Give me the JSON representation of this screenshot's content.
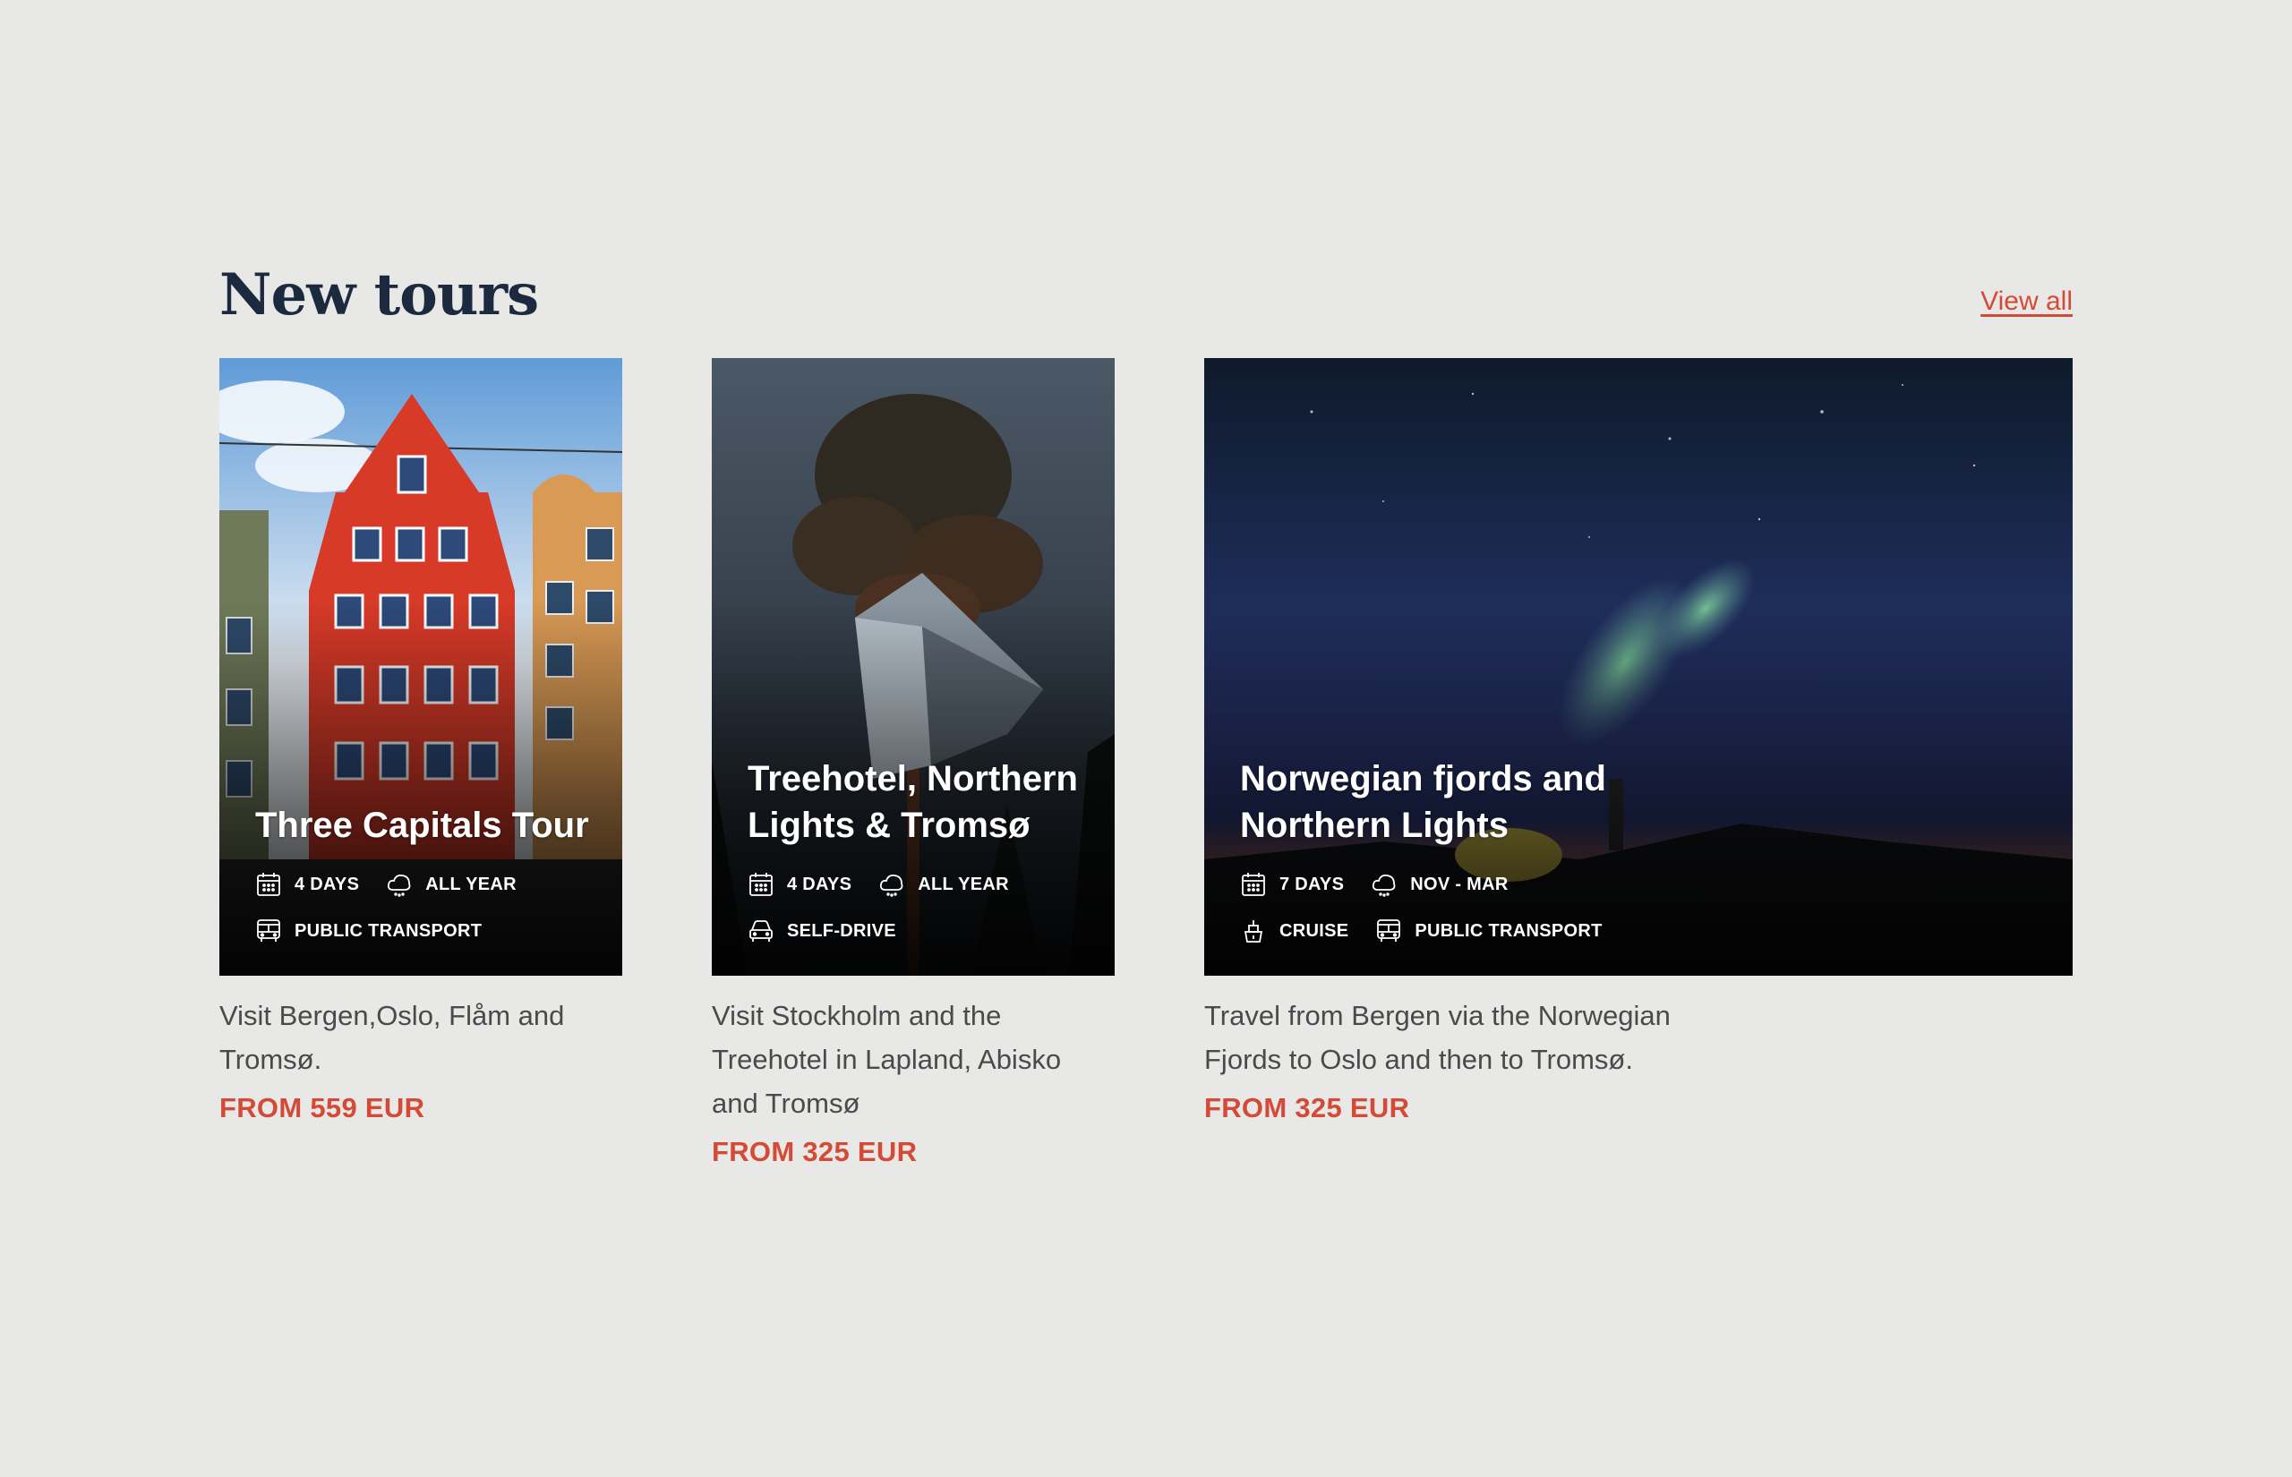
{
  "section": {
    "title": "New tours",
    "view_all": "View all"
  },
  "tours": [
    {
      "title": "Three Capitals Tour",
      "duration": "4 DAYS",
      "season": "ALL YEAR",
      "transport": [
        "PUBLIC TRANSPORT"
      ],
      "transport_icons": [
        "bus-icon"
      ],
      "description": "Visit Bergen,Oslo, Flåm and Tromsø.",
      "price": "FROM 559 EUR"
    },
    {
      "title": "Treehotel, Northern Lights & Tromsø",
      "duration": "4 DAYS",
      "season": "ALL YEAR",
      "transport": [
        "SELF-DRIVE"
      ],
      "transport_icons": [
        "car-icon"
      ],
      "description": "Visit Stockholm and the Treehotel in Lapland, Abisko and Tromsø",
      "price": "FROM 325 EUR"
    },
    {
      "title": "Norwegian fjords and Northern Lights",
      "duration": "7 DAYS",
      "season": "NOV - MAR",
      "transport": [
        "CRUISE",
        "PUBLIC TRANSPORT"
      ],
      "transport_icons": [
        "ship-icon",
        "bus-icon"
      ],
      "description": "Travel from Bergen via the Norwegian Fjords to Oslo and then to Tromsø.",
      "price": "FROM 325 EUR"
    }
  ],
  "colors": {
    "background": "#e8e8e6",
    "heading": "#1c2a40",
    "accent": "#d44a36",
    "body_text": "#4a4a4a"
  }
}
